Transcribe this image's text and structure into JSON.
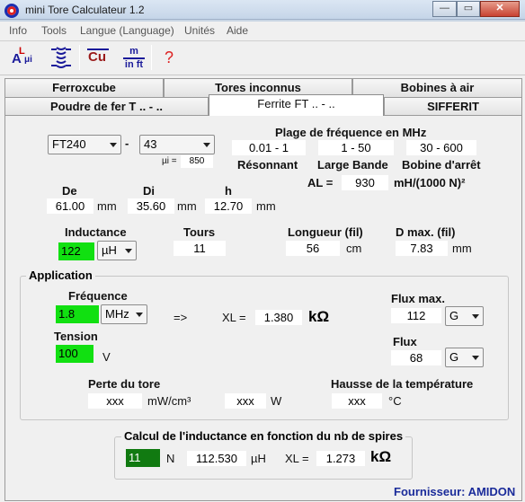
{
  "window": {
    "title": "mini Tore Calculateur 1.2",
    "min": "—",
    "max": "▭",
    "close": "✕"
  },
  "menu": [
    "Info",
    "Tools",
    "Langue (Language)",
    "Unités",
    "Aide"
  ],
  "toolbar": {
    "btn1": "A",
    "btn1b": "L",
    "btn1c": "μi",
    "btn3": "Cu",
    "btn4a": "m",
    "btn4b": "in ft",
    "btn5": "?"
  },
  "tabs_row1": [
    "Ferroxcube",
    "Tores inconnus",
    "Bobines à air"
  ],
  "tabs_row2": [
    "Poudre de fer T .. - ..",
    "Ferrite FT .. - ..",
    "SIFFERIT"
  ],
  "core": {
    "size": "FT240",
    "dash": "-",
    "material": "43",
    "mui_label": "µi =",
    "mui": "850"
  },
  "freq_range": {
    "title": "Plage de fréquence en MHz",
    "r1": "0.01 - 1",
    "r2": "1 - 50",
    "r3": "30 - 600",
    "l1": "Résonnant",
    "l2": "Large Bande",
    "l3": "Bobine d'arrêt",
    "al_label": "AL =",
    "al": "930",
    "al_unit": "mH/(1000 N)²"
  },
  "dims": {
    "de_label": "De",
    "di_label": "Di",
    "h_label": "h",
    "de": "61.00",
    "di": "35.60",
    "h": "12.70",
    "unit": "mm"
  },
  "coil": {
    "ind_label": "Inductance",
    "ind": "122",
    "ind_unit": "µH",
    "tours_label": "Tours",
    "tours": "11",
    "long_label": "Longueur (fil)",
    "long": "56",
    "long_unit": "cm",
    "dmax_label": "D max. (fil)",
    "dmax": "7.83",
    "dmax_unit": "mm"
  },
  "app": {
    "legend": "Application",
    "freq_label": "Fréquence",
    "freq": "1.8",
    "freq_unit": "MHz",
    "arrow": "=>",
    "xl_label": "XL =",
    "xl": "1.380",
    "xl_unit": "kΩ",
    "flux_max_label": "Flux max.",
    "flux_max": "112",
    "flux_max_unit": "G",
    "tension_label": "Tension",
    "tension": "100",
    "tension_unit": "V",
    "flux_label": "Flux",
    "flux": "68",
    "flux_unit": "G",
    "perte_label": "Perte du tore",
    "perte": "xxx",
    "perte_unit": "mW/cm³",
    "w": "xxx",
    "w_unit": "W",
    "hausse_label": "Hausse de la température",
    "hausse": "xxx",
    "hausse_unit": "°C"
  },
  "calc": {
    "legend": "Calcul de l'inductance en fonction du nb de spires",
    "n": "11",
    "n_unit": "N",
    "ind": "112.530",
    "ind_unit": "µH",
    "xl_label": "XL =",
    "xl": "1.273",
    "xl_unit": "kΩ"
  },
  "footer": {
    "supplier": "Fournisseur: AMIDON"
  },
  "colors": {
    "green": "#11e011",
    "dark_green": "#117a11",
    "supplier": "#1a2b9a"
  }
}
